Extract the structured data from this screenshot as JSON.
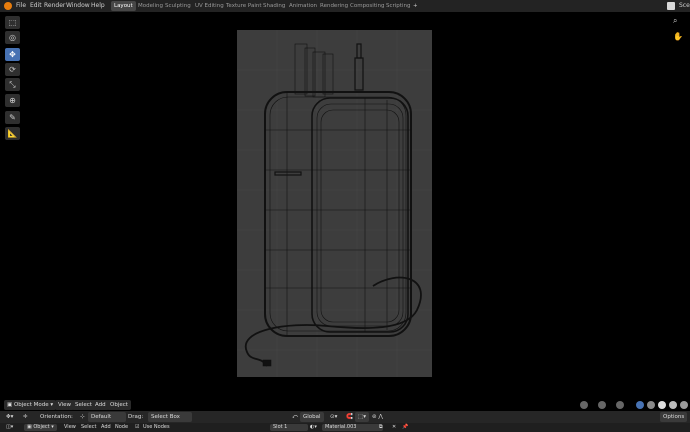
{
  "menu": {
    "file": "File",
    "edit": "Edit",
    "render": "Render",
    "window": "Window",
    "help": "Help"
  },
  "workspaces": [
    "Layout",
    "Modeling",
    "Sculpting",
    "UV Editing",
    "Texture Paint",
    "Shading",
    "Animation",
    "Rendering",
    "Compositing",
    "Scripting"
  ],
  "add_tab_label": "+",
  "scene_label": "Sce",
  "viewport_header": {
    "mode": "Object Mode",
    "view": "View",
    "select": "Select",
    "add": "Add",
    "object": "Object"
  },
  "tool_settings": {
    "orientation_label": "Orientation:",
    "orientation_value": "Default",
    "drag_label": "Drag:",
    "drag_value": "Select Box",
    "transform_value": "Global",
    "options": "Options"
  },
  "node_header": {
    "editor": "Object",
    "view": "View",
    "select": "Select",
    "add": "Add",
    "node": "Node",
    "use_nodes": "Use Nodes",
    "slot": "Slot 1",
    "material": "Material.003"
  },
  "colors": {
    "accent": "#4772b3",
    "camera_bg": "#3d3d3d",
    "wire": "#111111"
  }
}
